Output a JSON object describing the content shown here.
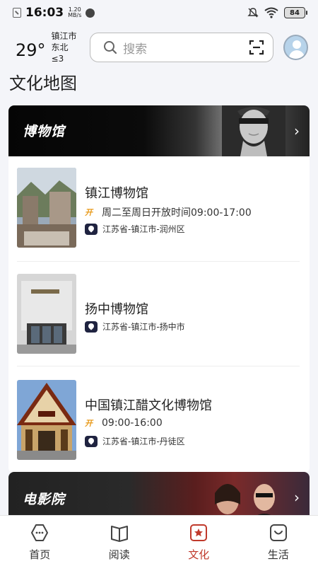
{
  "status_bar": {
    "time": "16:03",
    "speed_value": "1.20",
    "speed_unit": "MB/s",
    "battery": "84"
  },
  "header": {
    "temperature": "29°",
    "city": "镇江市",
    "wind": "东北 ≤3",
    "search_placeholder": "搜索"
  },
  "page_title": "文化地图",
  "museum_section": {
    "label": "博物馆",
    "items": [
      {
        "name": "镇江博物馆",
        "hours": "周二至周日开放时间09:00-17:00",
        "address": "江苏省-镇江市-润州区"
      },
      {
        "name": "扬中博物馆",
        "address": "江苏省-镇江市-扬中市"
      },
      {
        "name": "中国镇江醋文化博物馆",
        "hours": "09:00-16:00",
        "address": "江苏省-镇江市-丹徒区"
      }
    ],
    "open_badge_text": "开"
  },
  "cinema_section": {
    "label": "电影院"
  },
  "bottom_nav": [
    {
      "label": "首页",
      "icon": "home-icon"
    },
    {
      "label": "阅读",
      "icon": "book-icon"
    },
    {
      "label": "文化",
      "icon": "culture-icon",
      "active": true
    },
    {
      "label": "生活",
      "icon": "life-icon"
    }
  ],
  "colors": {
    "accent": "#c0392b",
    "open_badge": "#e89a1b",
    "pin_badge": "#1f2340"
  }
}
